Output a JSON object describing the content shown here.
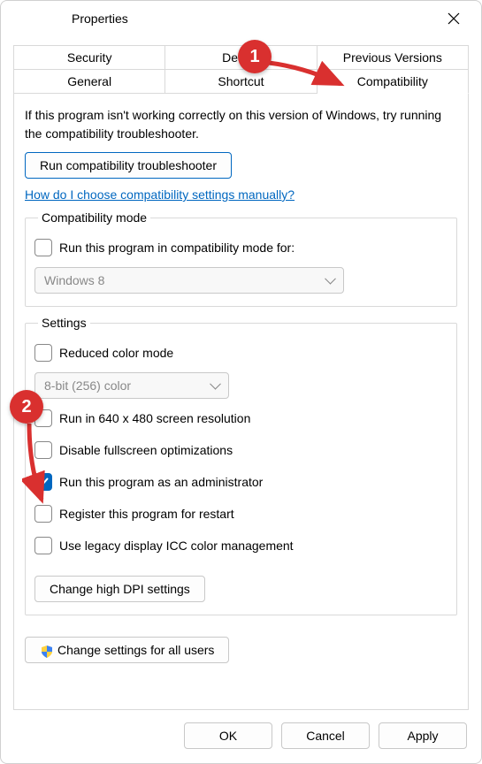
{
  "window": {
    "title": "Properties"
  },
  "tabs": {
    "row1": [
      "Security",
      "Details",
      "Previous Versions"
    ],
    "row2": [
      "General",
      "Shortcut",
      "Compatibility"
    ],
    "active": "Compatibility"
  },
  "panel": {
    "intro": "If this program isn't working correctly on this version of Windows, try running the compatibility troubleshooter.",
    "run_troubleshooter": "Run compatibility troubleshooter",
    "manual_link": "How do I choose compatibility settings manually?"
  },
  "compat_mode": {
    "legend": "Compatibility mode",
    "check_label": "Run this program in compatibility mode for:",
    "select_value": "Windows 8"
  },
  "settings": {
    "legend": "Settings",
    "reduced_color": "Reduced color mode",
    "color_select": "8-bit (256) color",
    "run_640": "Run in 640 x 480 screen resolution",
    "disable_fullscreen": "Disable fullscreen optimizations",
    "run_admin": "Run this program as an administrator",
    "register_restart": "Register this program for restart",
    "legacy_icc": "Use legacy display ICC color management",
    "dpi_btn": "Change high DPI settings"
  },
  "all_users_btn": "Change settings for all users",
  "footer": {
    "ok": "OK",
    "cancel": "Cancel",
    "apply": "Apply"
  },
  "callouts": {
    "c1": "1",
    "c2": "2"
  }
}
